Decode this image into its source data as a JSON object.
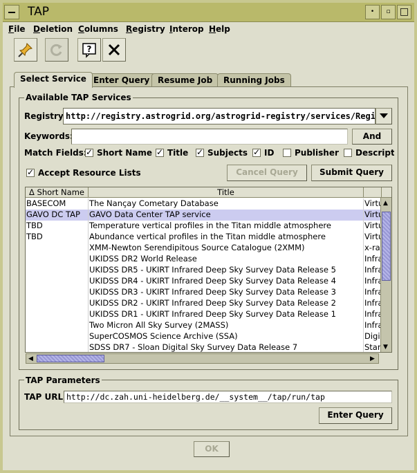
{
  "window": {
    "title": "TAP"
  },
  "menu": [
    {
      "label": "File",
      "u": "F"
    },
    {
      "label": "Deletion",
      "u": "D"
    },
    {
      "label": "Columns",
      "u": "C"
    },
    {
      "label": "Registry",
      "u": "R"
    },
    {
      "label": "Interop",
      "u": "I"
    },
    {
      "label": "Help",
      "u": "H"
    }
  ],
  "tabs": [
    "Select Service",
    "Enter Query",
    "Resume Job",
    "Running Jobs"
  ],
  "services": {
    "group_title": "Available TAP Services",
    "registry_label": "Registry:",
    "registry_value": "http://registry.astrogrid.org/astrogrid-registry/services/RegistryQueryv",
    "keywords_label": "Keywords:",
    "keywords_value": "",
    "and_button": "And",
    "match_label": "Match Fields:",
    "match_fields": [
      {
        "label": "Short Name",
        "checked": true
      },
      {
        "label": "Title",
        "checked": true
      },
      {
        "label": "Subjects",
        "checked": true
      },
      {
        "label": "ID",
        "checked": true
      },
      {
        "label": "Publisher",
        "checked": false
      },
      {
        "label": "Descripti",
        "checked": false
      }
    ],
    "accept_lists_label": "Accept Resource Lists",
    "cancel_query_button": "Cancel Query",
    "submit_query_button": "Submit Query"
  },
  "table": {
    "columns": [
      "Δ Short Name",
      "Title",
      ""
    ],
    "rows": [
      [
        "BASECOM",
        "The Nançay Cometary Database",
        "Virtu"
      ],
      [
        "GAVO DC TAP",
        "GAVO Data Center TAP service",
        "Virtu"
      ],
      [
        "TBD",
        "Temperature vertical profiles in the Titan middle atmosphere",
        "Virtu"
      ],
      [
        "TBD",
        "Abundance vertical profiles in the Titan middle atmosphere",
        "Virtu"
      ],
      [
        "",
        "XMM-Newton Serendipitous Source Catalogue (2XMM)",
        "x-ra"
      ],
      [
        "",
        "UKIDSS DR2 World Release",
        "Infra"
      ],
      [
        "",
        "UKIDSS DR5 - UKIRT Infrared Deep Sky Survey Data Release 5",
        "Infra"
      ],
      [
        "",
        "UKIDSS DR4 - UKIRT Infrared Deep Sky Survey Data Release 4",
        "Infra"
      ],
      [
        "",
        "UKIDSS DR3 - UKIRT Infrared Deep Sky Survey Data Release 3",
        "Infra"
      ],
      [
        "",
        "UKIDSS DR2 - UKIRT Infrared Deep Sky Survey Data Release 2",
        "Infra"
      ],
      [
        "",
        "UKIDSS DR1 - UKIRT Infrared Deep Sky Survey Data Release 1",
        "Infra"
      ],
      [
        "",
        "Two Micron All Sky Survey (2MASS)",
        "Infra"
      ],
      [
        "",
        "SuperCOSMOS Science Archive (SSA)",
        "Digi"
      ],
      [
        "",
        "SDSS DR7 - Sloan Digital Sky Survey Data Release 7",
        "Star"
      ]
    ],
    "selected_row": 1
  },
  "params": {
    "group_title": "TAP Parameters",
    "url_label": "TAP URL:",
    "url_value": "http://dc.zah.uni-heidelberg.de/__system__/tap/run/tap",
    "enter_query_button": "Enter Query"
  },
  "ok_button": "OK",
  "colors": {
    "title_bar": "#b9b96a",
    "selected_row": "#ccccf0",
    "background": "#dedecd"
  }
}
